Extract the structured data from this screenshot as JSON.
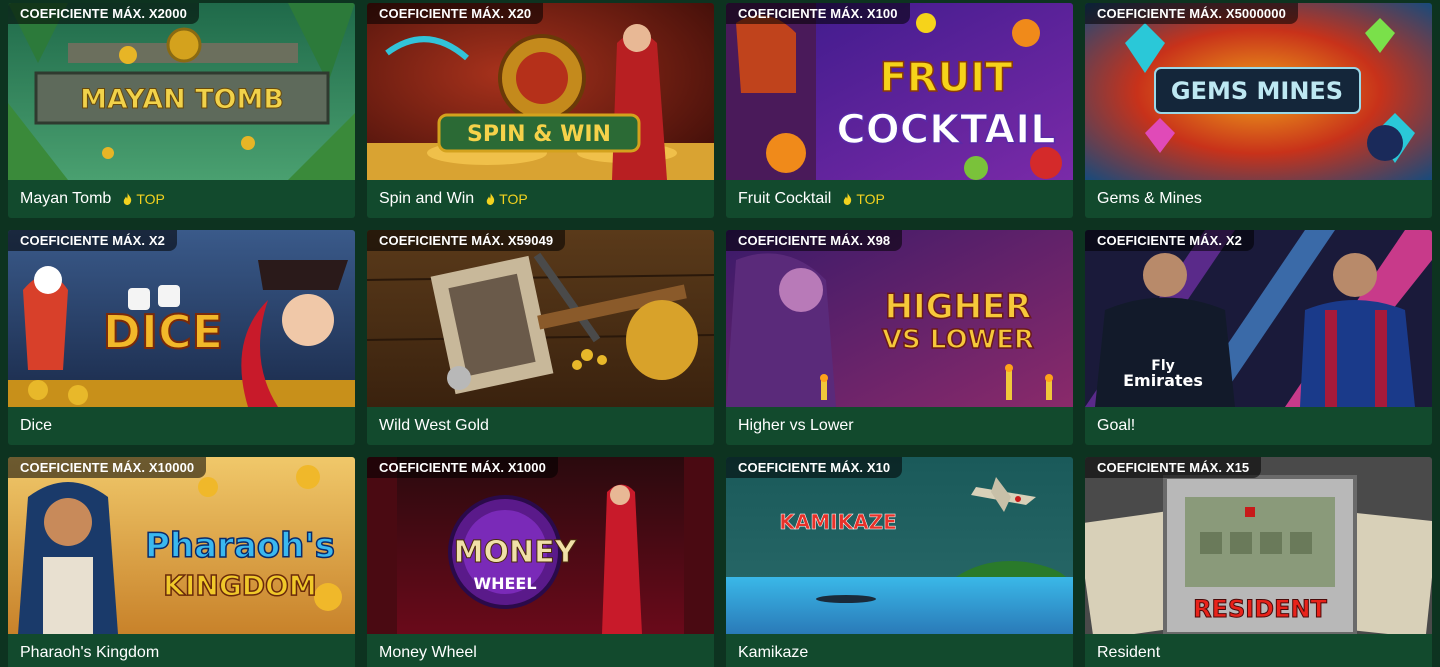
{
  "coef_prefix": "COEFICIENTE MÁX.",
  "top_label": "TOP",
  "colors": {
    "page_bg": "#0d3320",
    "card_footer_bg": "#124a2d",
    "top_badge": "#f3d21f"
  },
  "games": [
    {
      "name": "Mayan Tomb",
      "coef": "COEFICIENTE MÁX. X2000",
      "top": "TOP",
      "logo": "MAYAN TOMB"
    },
    {
      "name": "Spin and Win",
      "coef": "COEFICIENTE MÁX. X20",
      "top": "TOP",
      "logo": "SPIN & WIN"
    },
    {
      "name": "Fruit Cocktail",
      "coef": "COEFICIENTE MÁX. X100",
      "top": "TOP",
      "logo1": "FRUIT",
      "logo2": "COCKTAIL"
    },
    {
      "name": "Gems & Mines",
      "coef": "COEFICIENTE MÁX. X5000000",
      "logo": "GEMS MINES"
    },
    {
      "name": "Dice",
      "coef": "COEFICIENTE MÁX. X2",
      "logo": "DICE"
    },
    {
      "name": "Wild West Gold",
      "coef": "COEFICIENTE MÁX. X59049"
    },
    {
      "name": "Higher vs Lower",
      "coef": "COEFICIENTE MÁX. X98",
      "logo1": "HIGHER",
      "logo2": "VS LOWER"
    },
    {
      "name": "Goal!",
      "coef": "COEFICIENTE MÁX. X2",
      "logo1": "Fly",
      "logo2": "Emirates"
    },
    {
      "name": "Pharaoh's Kingdom",
      "coef": "COEFICIENTE MÁX. X10000",
      "logo1": "Pharaoh's",
      "logo2": "KINGDOM"
    },
    {
      "name": "Money Wheel",
      "coef": "COEFICIENTE MÁX. X1000",
      "logo1": "MONEY",
      "logo2": "WHEEL"
    },
    {
      "name": "Kamikaze",
      "coef": "COEFICIENTE MÁX. X10",
      "logo": "KAMIKAZE"
    },
    {
      "name": "Resident",
      "coef": "COEFICIENTE MÁX. X15",
      "logo": "RESIDENT"
    }
  ]
}
